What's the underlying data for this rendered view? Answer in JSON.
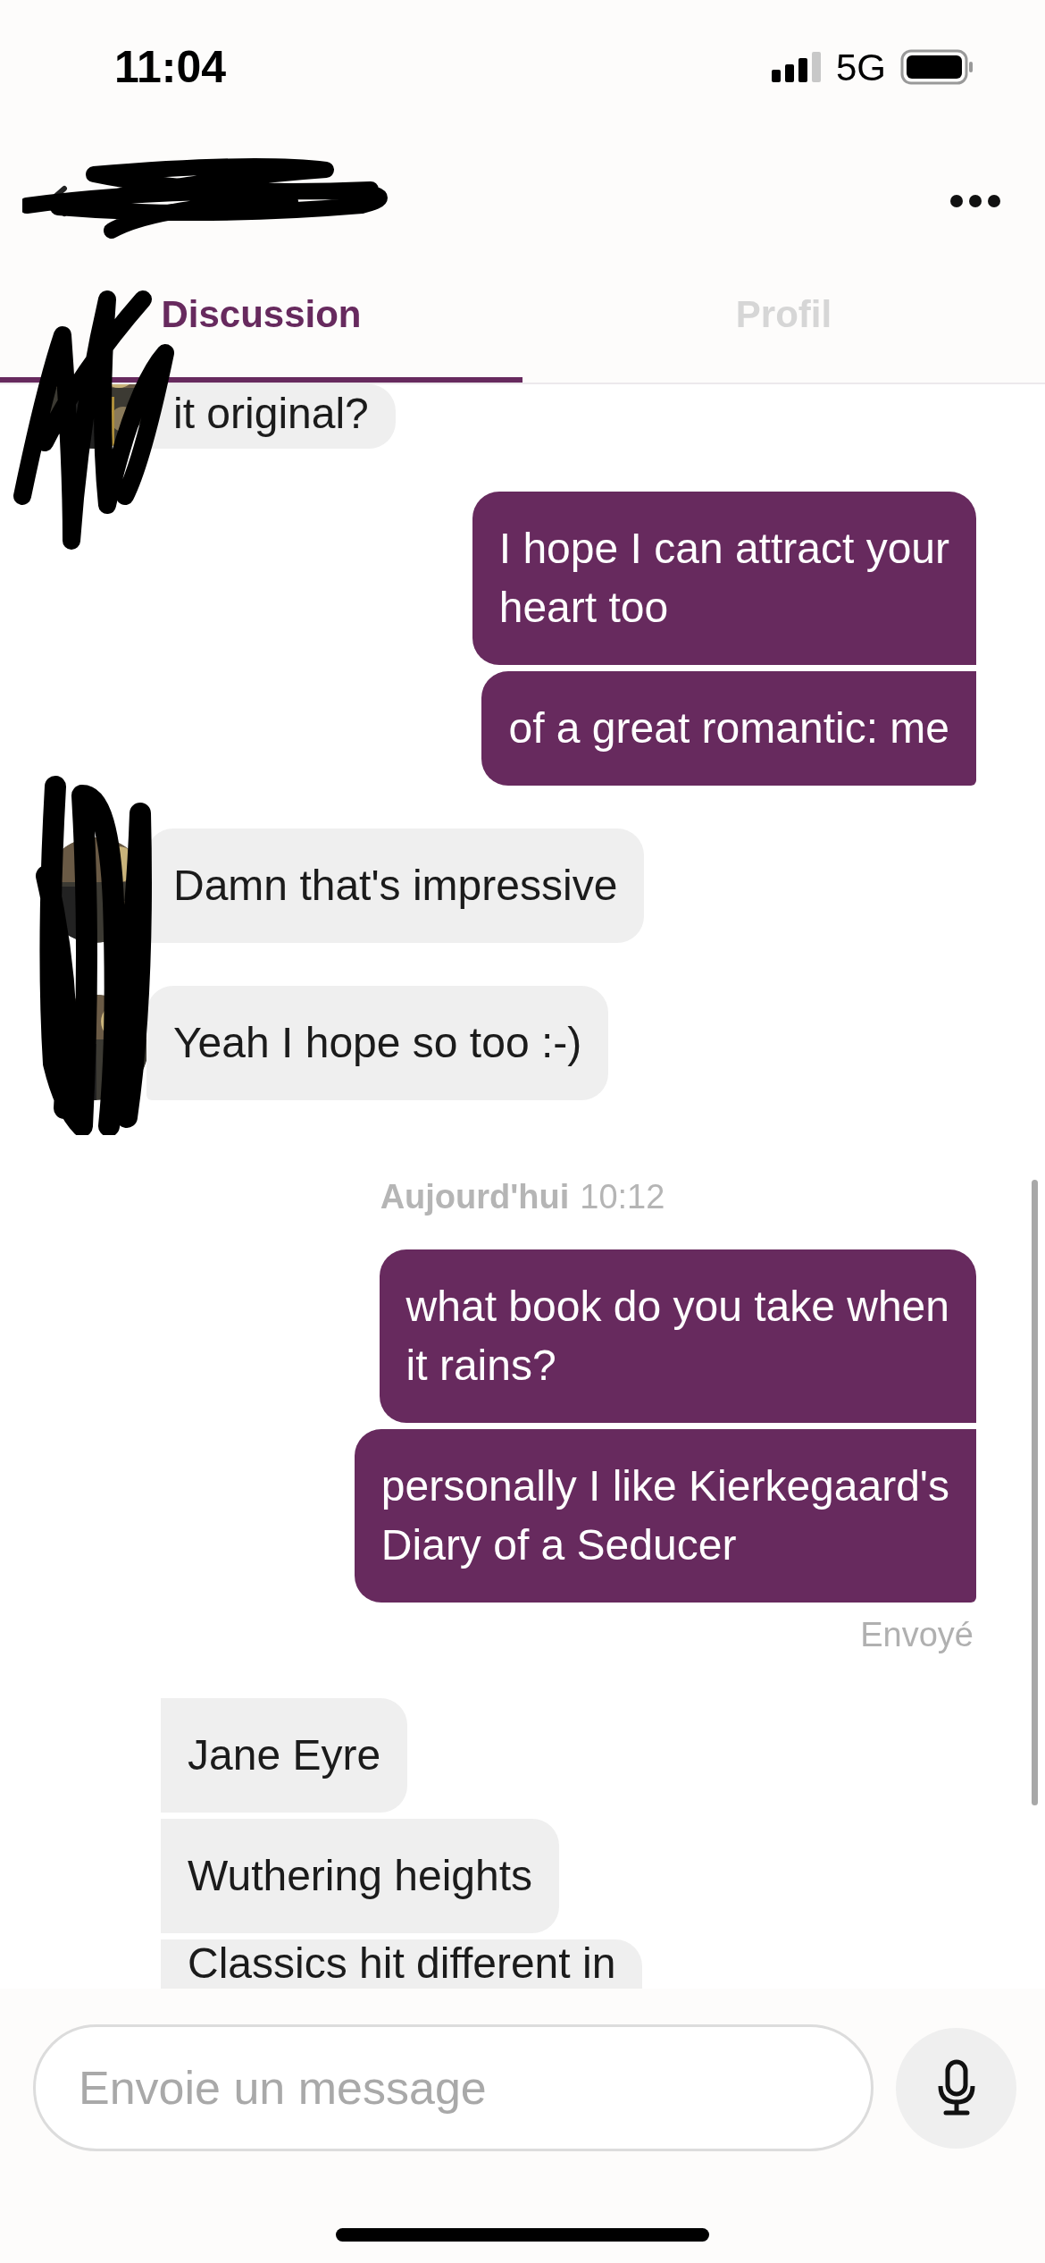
{
  "status_bar": {
    "time": "11:04",
    "network": "5G"
  },
  "tabs": [
    {
      "label": "Discussion",
      "selected": true
    },
    {
      "label": "Profil",
      "selected": false
    }
  ],
  "messages": [
    {
      "kind": "received",
      "text": "it original?",
      "avatar": true
    },
    {
      "kind": "sent",
      "text": "I hope I can attract your\nheart too",
      "tail": false
    },
    {
      "kind": "sent",
      "text": "of a great romantic: me",
      "tail": true
    },
    {
      "kind": "received",
      "text": "Damn that's impressive",
      "avatar": true
    },
    {
      "kind": "received",
      "text": "Yeah I hope so too :-)",
      "avatar": true
    },
    {
      "kind": "date",
      "day": "Aujourd'hui",
      "time": "10:12"
    },
    {
      "kind": "sent",
      "text": "what book do you take when\nit rains?",
      "tail": false
    },
    {
      "kind": "sent",
      "text": "personally I like Kierkegaard's\nDiary of a Seducer",
      "tail": true
    },
    {
      "kind": "status",
      "text": "Envoyé"
    },
    {
      "kind": "received",
      "text": "Jane Eyre",
      "avatar": false
    },
    {
      "kind": "received",
      "text": "Wuthering heights",
      "avatar": false
    },
    {
      "kind": "received",
      "text": "Classics hit different in",
      "avatar": false
    }
  ],
  "composer": {
    "placeholder": "Envoie un message"
  }
}
